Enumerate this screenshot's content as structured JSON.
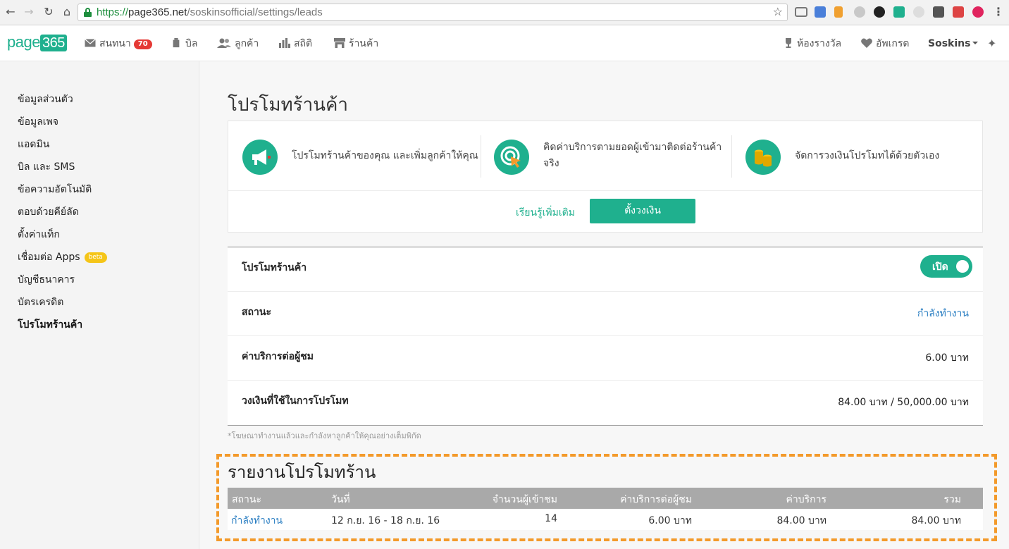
{
  "browser": {
    "url_scheme": "https://",
    "url_host": "page365.net",
    "url_path": "/soskinsofficial/settings/leads"
  },
  "header": {
    "logo_text": "page",
    "logo_box": "365",
    "nav": [
      {
        "label": "สนทนา",
        "icon": "envelope-icon",
        "badge": "70"
      },
      {
        "label": "บิล",
        "icon": "bill-icon"
      },
      {
        "label": "ลูกค้า",
        "icon": "customers-icon"
      },
      {
        "label": "สถิติ",
        "icon": "stats-icon"
      },
      {
        "label": "ร้านค้า",
        "icon": "store-icon"
      }
    ],
    "right": {
      "awards": "ห้องรางวัล",
      "upgrade": "อัพเกรด",
      "user": "Soskins"
    }
  },
  "sidebar": {
    "items": [
      {
        "label": "ข้อมูลส่วนตัว"
      },
      {
        "label": "ข้อมูลเพจ"
      },
      {
        "label": "แอดมิน"
      },
      {
        "label": "บิล และ SMS"
      },
      {
        "label": "ข้อความอัตโนมัติ"
      },
      {
        "label": "ตอบด้วยคีย์ลัด"
      },
      {
        "label": "ตั้งค่าแท็ก"
      },
      {
        "label": "เชื่อมต่อ Apps",
        "badge": "beta"
      },
      {
        "label": "บัญชีธนาคาร"
      },
      {
        "label": "บัตรเครดิต"
      },
      {
        "label": "โปรโมทร้านค้า",
        "active": true
      }
    ]
  },
  "main": {
    "title": "โปรโมทร้านค้า",
    "features": [
      {
        "text": "โปรโมทร้านค้าของคุณ และเพิ่มลูกค้าให้คุณ",
        "icon": "megaphone-icon"
      },
      {
        "text_line1": "คิดค่าบริการตามยอดผู้เข้ามาติดต่อร้านค้า",
        "text_line2": "จริง",
        "icon": "target-click-icon"
      },
      {
        "text": "จัดการวงเงินโปรโมทได้ด้วยตัวเอง",
        "icon": "coins-icon"
      }
    ],
    "learn_more": "เรียนรู้เพิ่มเติม",
    "set_budget": "ตั้งวงเงิน",
    "settings": {
      "promote_label": "โปรโมทร้านค้า",
      "toggle_label": "เปิด",
      "status_label": "สถานะ",
      "status_value": "กำลังทำงาน",
      "cost_label": "ค่าบริการต่อผู้ชม",
      "cost_value": "6.00 บาท",
      "budget_label": "วงเงินที่ใช้ในการโปรโมท",
      "budget_value": "84.00 บาท / 50,000.00 บาท"
    },
    "footnote": "*โฆษณาทำงานแล้วและกำลังหาลูกค้าให้คุณอย่างเต็มพิกัด",
    "report": {
      "title": "รายงานโปรโมทร้าน",
      "columns": [
        "สถานะ",
        "วันที่",
        "จำนวนผู้เข้าชม",
        "ค่าบริการต่อผู้ชม",
        "ค่าบริการ",
        "รวม"
      ],
      "rows": [
        [
          "กำลังทำงาน",
          "12 ก.ย. 16 - 18 ก.ย. 16",
          "14",
          "6.00 บาท",
          "84.00 บาท",
          "84.00 บาท"
        ]
      ]
    }
  },
  "colors": {
    "brand": "#1fb08e",
    "link": "#2a7ec2",
    "badge": "#e53935",
    "highlight": "#f39a2b"
  }
}
